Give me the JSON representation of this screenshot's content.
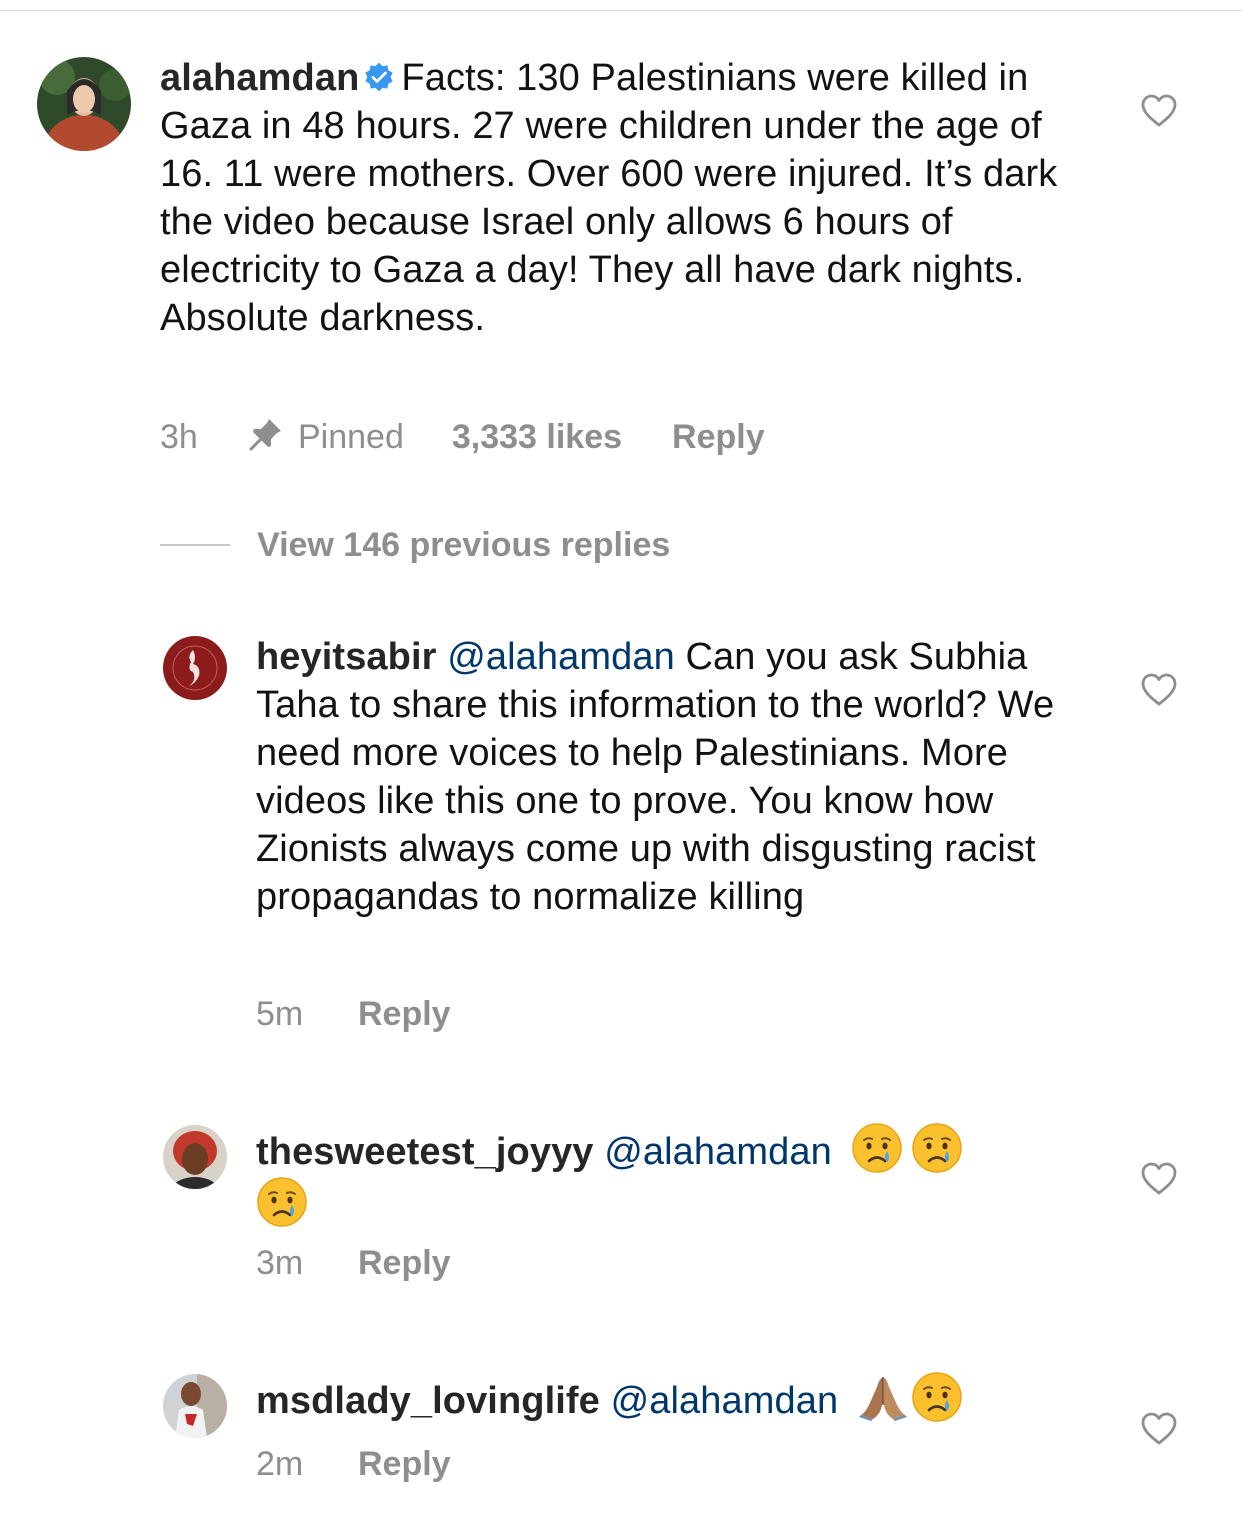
{
  "main_comment": {
    "username": "alahamdan",
    "verified": true,
    "text": "Facts: 130 Palestinians were killed in Gaza in 48 hours. 27 were children under the age of 16. 11 were mothers. Over 600 were injured. It’s dark the video because Israel only allows 6 hours of electricity to Gaza a day! They all have dark nights. Absolute darkness.",
    "time": "3h",
    "pinned_label": "Pinned",
    "likes": "3,333 likes",
    "reply_label": "Reply"
  },
  "view_previous_replies": "View 146 previous replies",
  "replies": [
    {
      "username": "heyitsabir",
      "mention": "@alahamdan",
      "text": "Can you ask Subhia Taha to share this information to the world? We need more voices to help Palestinians. More videos like this one to prove. You know how Zionists always come up with disgusting racist propagandas to normalize killing",
      "time": "5m",
      "reply_label": "Reply"
    },
    {
      "username": "thesweetest_joyyy",
      "mention": "@alahamdan",
      "emojis": [
        "crying-face",
        "crying-face",
        "crying-face"
      ],
      "time": "3m",
      "reply_label": "Reply"
    },
    {
      "username": "msdlady_lovinglife",
      "mention": "@alahamdan",
      "emojis": [
        "folded-hands",
        "crying-face"
      ],
      "time": "2m",
      "reply_label": "Reply"
    }
  ],
  "icons": {
    "like": "heart-outline-icon",
    "pin": "pin-icon",
    "verified": "verified-badge-icon"
  },
  "colors": {
    "username": "#262626",
    "mention": "#00376b",
    "meta": "#8e8e8e",
    "verified": "#3897f0"
  }
}
